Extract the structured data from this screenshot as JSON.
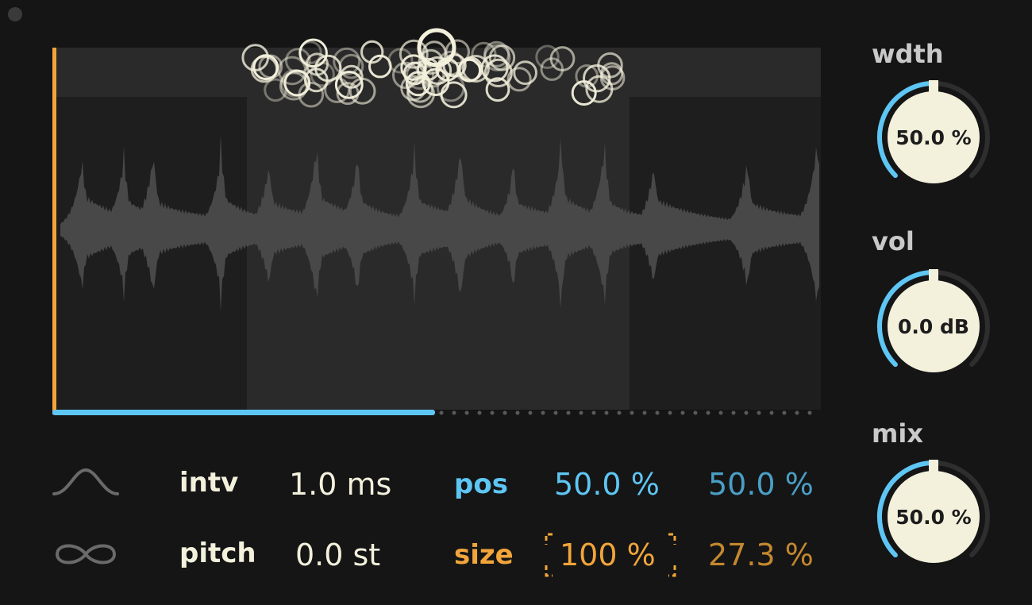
{
  "grain_display": {
    "position_start": 0.25,
    "position_end": 0.75,
    "playhead_progress": 0.5
  },
  "params": {
    "interval": {
      "label": "intv",
      "value": "1.0 ms"
    },
    "pitch": {
      "label": "pitch",
      "value": "0.0 st"
    },
    "position": {
      "label": "pos",
      "value": "50.0 %",
      "spread": "50.0 %"
    },
    "size": {
      "label": "size",
      "value": "100 %",
      "spread": "27.3 %"
    }
  },
  "icons": {
    "envelope": "bell-curve-icon",
    "loop": "infinity-icon"
  },
  "knobs": {
    "width": {
      "title": "wdth",
      "value": "50.0 %",
      "level": 0.5
    },
    "volume": {
      "title": "vol",
      "value": "0.0 dB",
      "level": 0.5
    },
    "mix": {
      "title": "mix",
      "value": "50.0 %",
      "level": 0.5
    }
  },
  "colors": {
    "accent_blue": "#5ec6f4",
    "accent_orange": "#f2a53a",
    "grain": "#f3f0dc",
    "background": "#151515",
    "knob_face": "#f3f0dc"
  }
}
